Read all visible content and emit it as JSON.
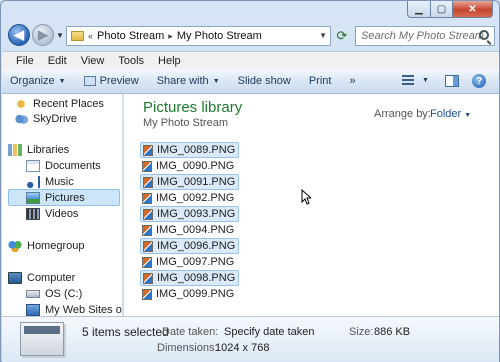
{
  "address": {
    "history_glyph": "«",
    "crumbs": [
      "Photo Stream",
      "My Photo Stream"
    ],
    "separator": "▸"
  },
  "search": {
    "placeholder": "Search My Photo Stream"
  },
  "menu": [
    "File",
    "Edit",
    "View",
    "Tools",
    "Help"
  ],
  "toolbar": {
    "organize": "Organize",
    "preview": "Preview",
    "share": "Share with",
    "slideshow": "Slide show",
    "print": "Print",
    "more": "»"
  },
  "nav": {
    "recent": "Recent Places",
    "skydrive": "SkyDrive",
    "libraries": "Libraries",
    "documents": "Documents",
    "music": "Music",
    "pictures": "Pictures",
    "videos": "Videos",
    "homegroup": "Homegroup",
    "computer": "Computer",
    "os": "OS (C:)",
    "web": "My Web Sites on"
  },
  "library": {
    "title": "Pictures library",
    "subtitle": "My Photo Stream",
    "arrange_label": "Arrange by:",
    "arrange_value": "Folder"
  },
  "files": [
    {
      "name": "IMG_0089.PNG",
      "selected": true
    },
    {
      "name": "IMG_0090.PNG",
      "selected": false
    },
    {
      "name": "IMG_0091.PNG",
      "selected": true
    },
    {
      "name": "IMG_0092.PNG",
      "selected": false
    },
    {
      "name": "IMG_0093.PNG",
      "selected": true
    },
    {
      "name": "IMG_0094.PNG",
      "selected": false
    },
    {
      "name": "IMG_0096.PNG",
      "selected": true
    },
    {
      "name": "IMG_0097.PNG",
      "selected": false
    },
    {
      "name": "IMG_0098.PNG",
      "selected": true
    },
    {
      "name": "IMG_0099.PNG",
      "selected": false
    }
  ],
  "details": {
    "count": "5 items selected",
    "date_label": "Date taken:",
    "date_value": "Specify date taken",
    "size_label": "Size:",
    "size_value": "886 KB",
    "dim_label": "Dimensions:",
    "dim_value": "1024 x 768"
  }
}
